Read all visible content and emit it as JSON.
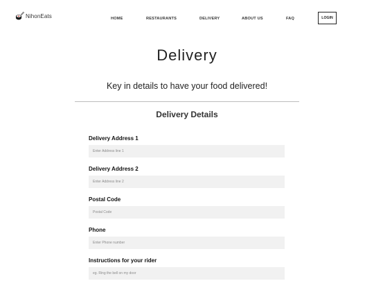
{
  "brand": {
    "name": "NihonEats"
  },
  "nav": {
    "items": [
      "HOME",
      "RESTAURANTS",
      "DELIVERY",
      "ABOUT US",
      "FAQ"
    ],
    "login_label": "LOGIN"
  },
  "page": {
    "title": "Delivery",
    "subtitle": "Key in details to have your food delivered!",
    "section_title": "Delivery Details"
  },
  "form": {
    "fields": [
      {
        "label": "Delivery Address 1",
        "placeholder": "Enter Address line 1",
        "value": ""
      },
      {
        "label": "Delivery Address 2",
        "placeholder": "Enter Address line 2",
        "value": ""
      },
      {
        "label": "Postal Code",
        "placeholder": "Postal Code",
        "value": ""
      },
      {
        "label": "Phone",
        "placeholder": "Enter Phone number",
        "value": ""
      },
      {
        "label": "Instructions for your rider",
        "placeholder": "eg. Ring the bell on my door",
        "value": ""
      }
    ]
  },
  "colors": {
    "text": "#222222",
    "input_bg": "#f1f1f1",
    "divider": "#bdbdbd",
    "logo_red": "#d6332c"
  }
}
